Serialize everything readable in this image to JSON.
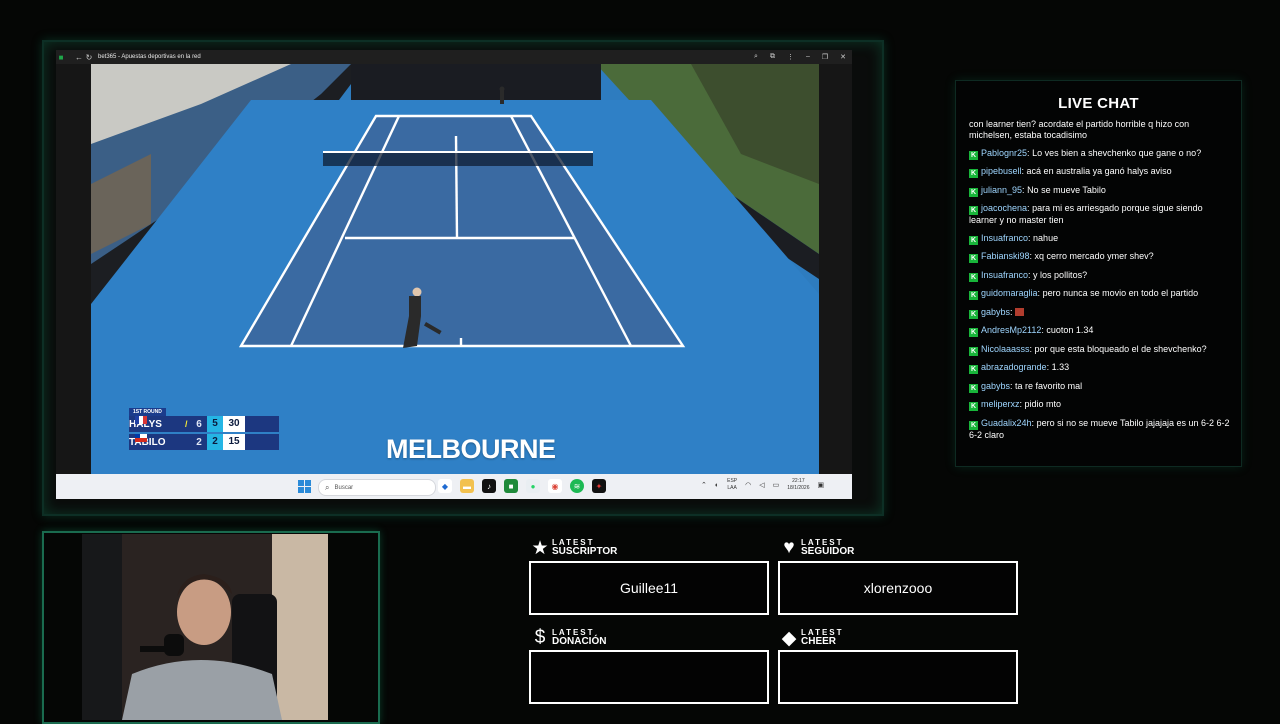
{
  "browser": {
    "title": "bet365 - Apuestas deportivas en la red"
  },
  "scoreboard": {
    "round": "1ST ROUND",
    "players": [
      {
        "name": "HALYS",
        "set1": "6",
        "set2": "5",
        "points": "30",
        "serving": true
      },
      {
        "name": "TABILO",
        "set1": "2",
        "set2": "2",
        "points": "15",
        "serving": false
      }
    ]
  },
  "video": {
    "venue": "MELBOURNE"
  },
  "taskbar": {
    "search_placeholder": "Buscar",
    "lang_line1": "ESP",
    "lang_line2": "LAA",
    "time": "22:17",
    "date": "18/1/2026"
  },
  "chat": {
    "title": "LIVE CHAT",
    "messages": [
      {
        "user": "",
        "text": "con learner tien? acordate el partido horrible q hizo con michelsen, estaba tocadisimo"
      },
      {
        "user": "Pablognr25",
        "text": "Lo ves bien a shevchenko que gane o no?"
      },
      {
        "user": "pipebusell",
        "text": "acá en australia ya ganó halys aviso"
      },
      {
        "user": "juliann_95",
        "text": "No se mueve Tabilo"
      },
      {
        "user": "joacochena",
        "text": "para mi es arriesgado porque sigue siendo learner y no master tien"
      },
      {
        "user": "Insuafranco",
        "text": "nahue"
      },
      {
        "user": "Fabianski98",
        "text": "xq cerro mercado ymer shev?"
      },
      {
        "user": "Insuafranco",
        "text": "y los pollitos?"
      },
      {
        "user": "guidomaraglia",
        "text": "pero nunca se movio en todo el partido"
      },
      {
        "user": "gabybs",
        "text": ""
      },
      {
        "user": "AndresMp2112",
        "text": "cuoton 1.34"
      },
      {
        "user": "Nicolaaasss",
        "text": "por que esta bloqueado el de shevchenko?"
      },
      {
        "user": "abrazadogrande",
        "text": "1.33"
      },
      {
        "user": "gabybs",
        "text": "ta re favorito mal"
      },
      {
        "user": "meliperxz",
        "text": "pidio mto"
      },
      {
        "user": "Guadalix24h",
        "text": "pero si no se mueve Tabilo jajajaja es un 6-2 6-2 6-2 claro"
      }
    ]
  },
  "alerts": {
    "suscriptor": {
      "small": "LATEST",
      "big": "SUSCRIPTOR",
      "value": "Guillee11"
    },
    "seguidor": {
      "small": "LATEST",
      "big": "SEGUIDOR",
      "value": "xlorenzooo"
    },
    "donacion": {
      "small": "LATEST",
      "big": "DONACIÓN",
      "value": ""
    },
    "cheer": {
      "small": "LATEST",
      "big": "CHEER",
      "value": ""
    }
  },
  "colors": {
    "accent_green": "#1a6b4f",
    "chat_badge": "#18b53a",
    "chat_username": "#9fd6ff",
    "court_blue": "#2e7cbf"
  }
}
